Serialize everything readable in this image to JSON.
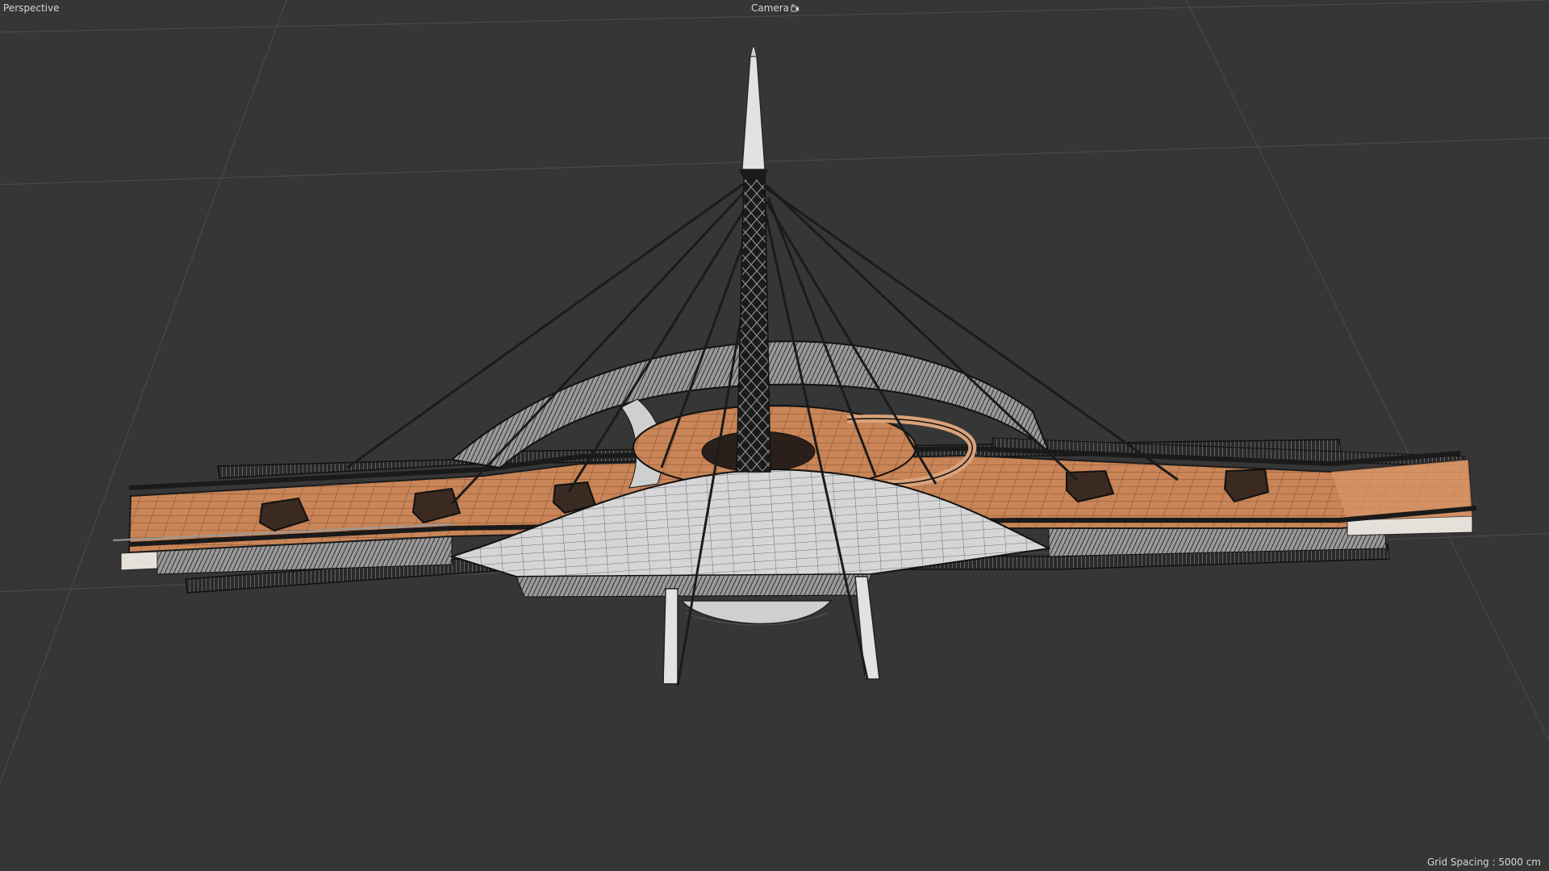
{
  "viewport": {
    "view_mode_label": "Perspective",
    "camera_label": "Camera",
    "camera_icon": "camera-lock-icon",
    "grid_spacing_label": "Grid Spacing : 5000 cm"
  },
  "scene": {
    "object": "cable-stayed bridge wireframe model",
    "colors": {
      "background": "#363636",
      "grid": "#4a4a4a",
      "deck_wood": "#c98557",
      "wire_dark": "#1b1b1b",
      "shell_light": "#d8d8d8",
      "label_text": "#d6d6d6"
    }
  }
}
